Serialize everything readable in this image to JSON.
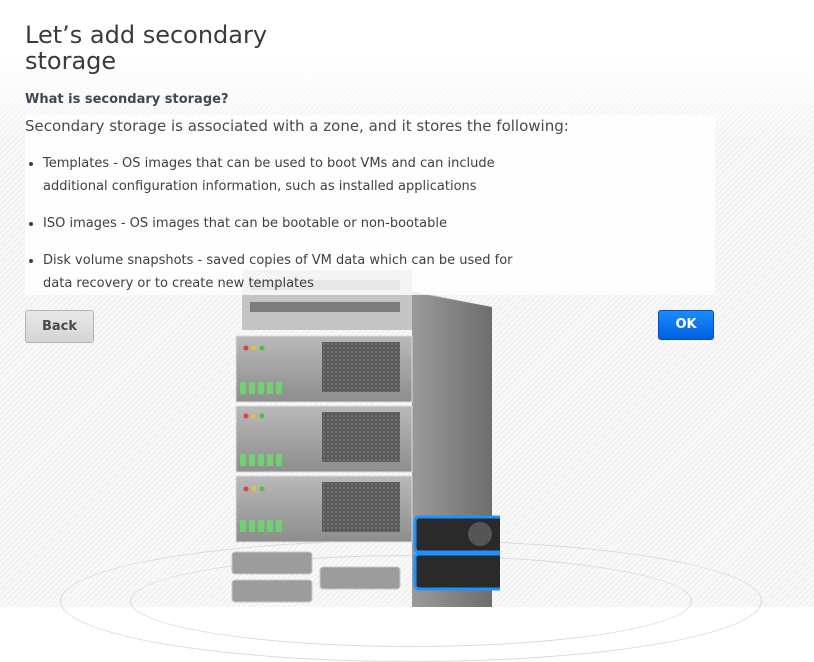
{
  "page": {
    "title": "Let’s add secondary storage",
    "subtitle": "What is secondary storage?",
    "intro": "Secondary storage is associated with a zone, and it stores the following:",
    "bullets": [
      "Templates - OS images that can be used to boot VMs and can include additional configuration information, such as installed applications",
      "ISO images - OS images that can be bootable or non-bootable",
      "Disk volume snapshots - saved copies of VM data which can be used for data recovery or to create new templates"
    ]
  },
  "buttons": {
    "back": "Back",
    "ok": "OK"
  },
  "colors": {
    "ok_button": "#0a72f0",
    "title_text": "#3b3b3b",
    "subtitle_text": "#3d4956",
    "highlight_glow": "#1e90ff"
  },
  "icons": {
    "illustration": "server-rack-with-disk-drives"
  }
}
